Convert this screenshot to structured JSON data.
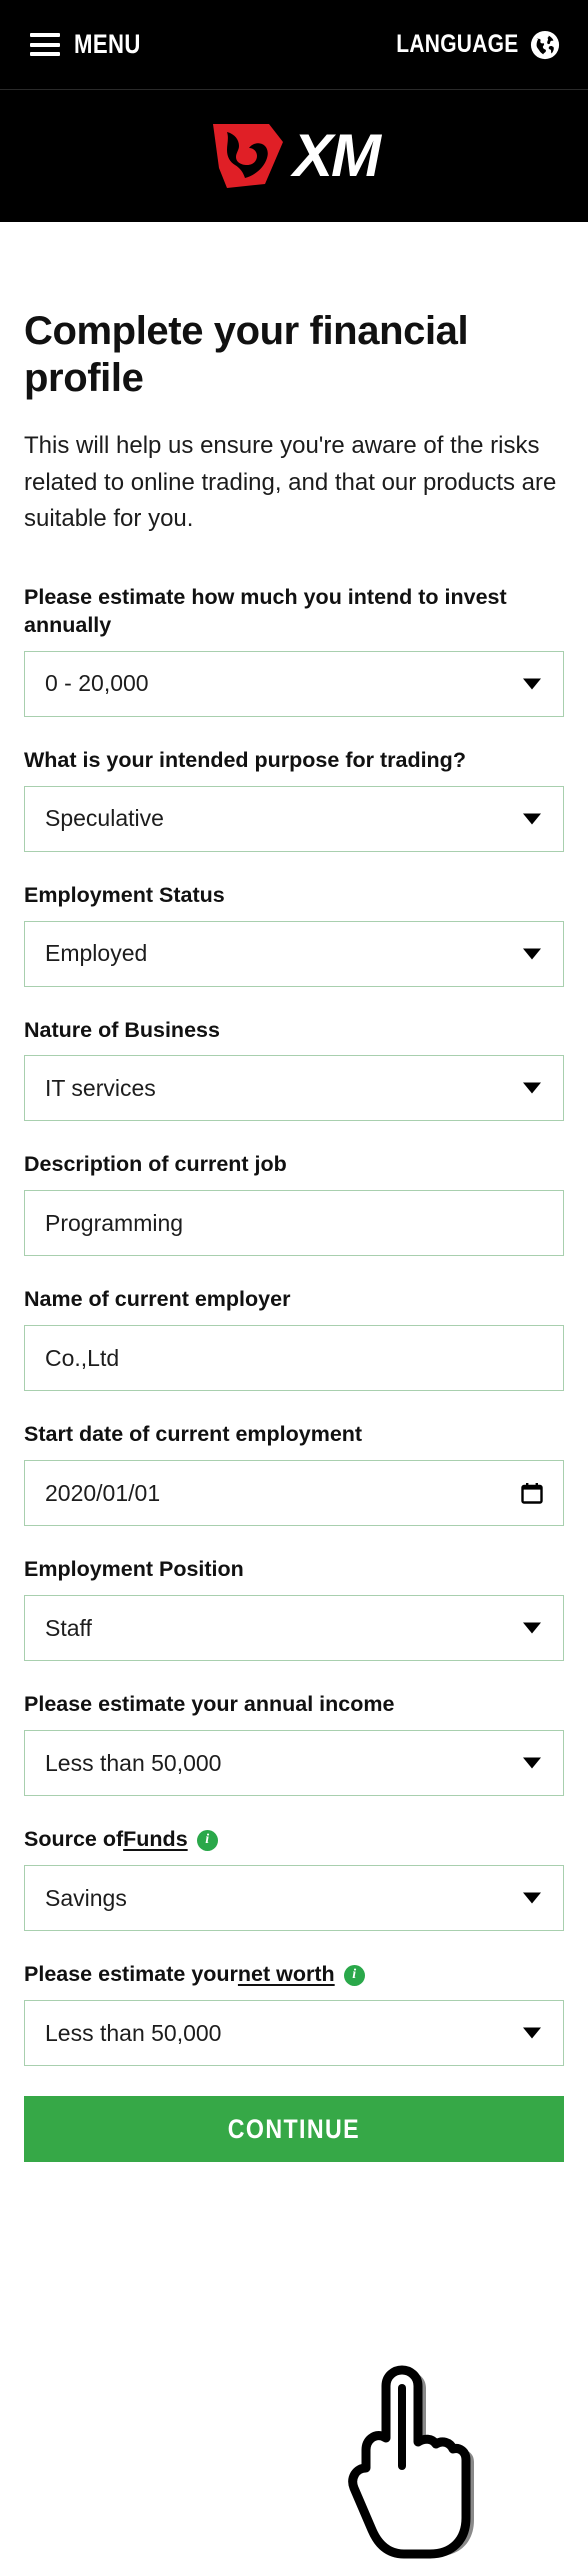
{
  "header": {
    "menu_label": "MENU",
    "menu_icon": "hamburger-icon",
    "language_label": "LANGUAGE",
    "language_icon": "globe-icon",
    "background_color": "#000000"
  },
  "brand": {
    "logo_text": "XM",
    "logo_icon": "xm-bull-logo",
    "mark_color": "#e01f26"
  },
  "main": {
    "title": "Complete your financial profile",
    "intro": "This will help us ensure you're aware of the risks related to online trading, and that our products are suitable for you."
  },
  "form": {
    "fields": [
      {
        "name": "annual-investment",
        "label": "Please estimate how much you intend to invest annually",
        "type": "select",
        "value": "0 - 20,000"
      },
      {
        "name": "trading-purpose",
        "label": "What is your intended purpose for trading?",
        "type": "select",
        "value": "Speculative"
      },
      {
        "name": "employment-status",
        "label": "Employment Status",
        "type": "select",
        "value": "Employed"
      },
      {
        "name": "nature-of-business",
        "label": "Nature of Business",
        "type": "select",
        "value": "IT services"
      },
      {
        "name": "job-description",
        "label": "Description of current job",
        "type": "text",
        "value": "Programming"
      },
      {
        "name": "employer-name",
        "label": "Name of current employer",
        "type": "text",
        "value": "Co.,Ltd"
      },
      {
        "name": "employment-start-date",
        "label": "Start date of current employment",
        "type": "date",
        "value": "2020/01/01"
      },
      {
        "name": "employment-position",
        "label": "Employment Position",
        "type": "select",
        "value": "Staff"
      },
      {
        "name": "annual-income",
        "label": "Please estimate your annual income",
        "type": "select",
        "value": "Less than 50,000"
      },
      {
        "name": "source-of-funds",
        "label_prefix": "Source of ",
        "label_underlined": "Funds",
        "label_suffix": "",
        "has_info_icon": true,
        "type": "select",
        "value": "Savings"
      },
      {
        "name": "net-worth",
        "label_prefix": "Please estimate your ",
        "label_underlined": "net worth",
        "label_suffix": "",
        "has_info_icon": true,
        "type": "select",
        "value": "Less than 50,000"
      }
    ],
    "border_color": "#a8cfae",
    "info_icon_color": "#2aa84a",
    "info_icon_glyph": "i"
  },
  "footer": {
    "continue_label": "CONTINUE",
    "continue_color": "#36a847",
    "cursor_icon": "pointing-hand-cursor"
  }
}
